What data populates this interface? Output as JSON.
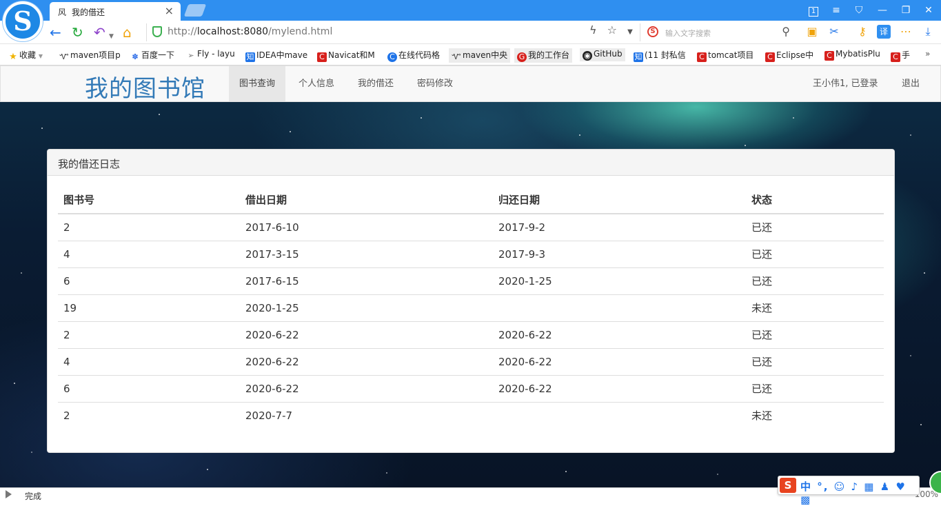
{
  "browser": {
    "tab": {
      "icon": "风",
      "title": "我的借还"
    },
    "url_prefix": "http://",
    "url_host": "localhost:8080",
    "url_path": "/mylend.html",
    "search_placeholder": "输入文字搜索",
    "window_counter": "1",
    "bookmarks": [
      {
        "label": "收藏",
        "icon": "star-icon"
      },
      {
        "label": "maven项目p",
        "icon": "maven-icon"
      },
      {
        "label": "百度一下",
        "icon": "baidu-paw-icon"
      },
      {
        "label": "Fly - layu",
        "icon": "paper-plane-icon"
      },
      {
        "label": "IDEA中mave",
        "icon": "zhihu-icon"
      },
      {
        "label": "Navicat和M",
        "icon": "csdn-icon"
      },
      {
        "label": "在线代码格",
        "icon": "c-icon"
      },
      {
        "label": "maven中央",
        "icon": "maven-icon"
      },
      {
        "label": "我的工作台",
        "icon": "gitee-icon"
      },
      {
        "label": "GitHub",
        "icon": "github-icon"
      },
      {
        "label": "(11 封私信",
        "icon": "zhihu-icon"
      },
      {
        "label": "tomcat项目",
        "icon": "csdn-icon"
      },
      {
        "label": "Eclipse中",
        "icon": "csdn-icon"
      },
      {
        "label": "MybatisPlu",
        "icon": "csdn-icon"
      },
      {
        "label": "手",
        "icon": "csdn-icon"
      }
    ],
    "bookmarks_more": "»",
    "status_text": "完成",
    "status_zoom": "100%",
    "ime_label": "中 °, ☺ ♪ ▦ ♟ ♥ ▩"
  },
  "site": {
    "brand": "我的图书馆",
    "nav": [
      {
        "label": "图书查询",
        "active": true
      },
      {
        "label": "个人信息",
        "active": false
      },
      {
        "label": "我的借还",
        "active": false
      },
      {
        "label": "密码修改",
        "active": false
      }
    ],
    "user_status": "王小伟1, 已登录",
    "logout": "退出"
  },
  "panel": {
    "title": "我的借还日志",
    "columns": [
      "图书号",
      "借出日期",
      "归还日期",
      "状态"
    ],
    "rows": [
      [
        "2",
        "2017-6-10",
        "2017-9-2",
        "已还"
      ],
      [
        "4",
        "2017-3-15",
        "2017-9-3",
        "已还"
      ],
      [
        "6",
        "2017-6-15",
        "2020-1-25",
        "已还"
      ],
      [
        "19",
        "2020-1-25",
        "",
        "未还"
      ],
      [
        "2",
        "2020-6-22",
        "2020-6-22",
        "已还"
      ],
      [
        "4",
        "2020-6-22",
        "2020-6-22",
        "已还"
      ],
      [
        "6",
        "2020-6-22",
        "2020-6-22",
        "已还"
      ],
      [
        "2",
        "2020-7-7",
        "",
        "未还"
      ]
    ]
  },
  "colors": {
    "brand": "#337ab7",
    "titlebar": "#2f8ff0",
    "secure": "#3cb050"
  }
}
